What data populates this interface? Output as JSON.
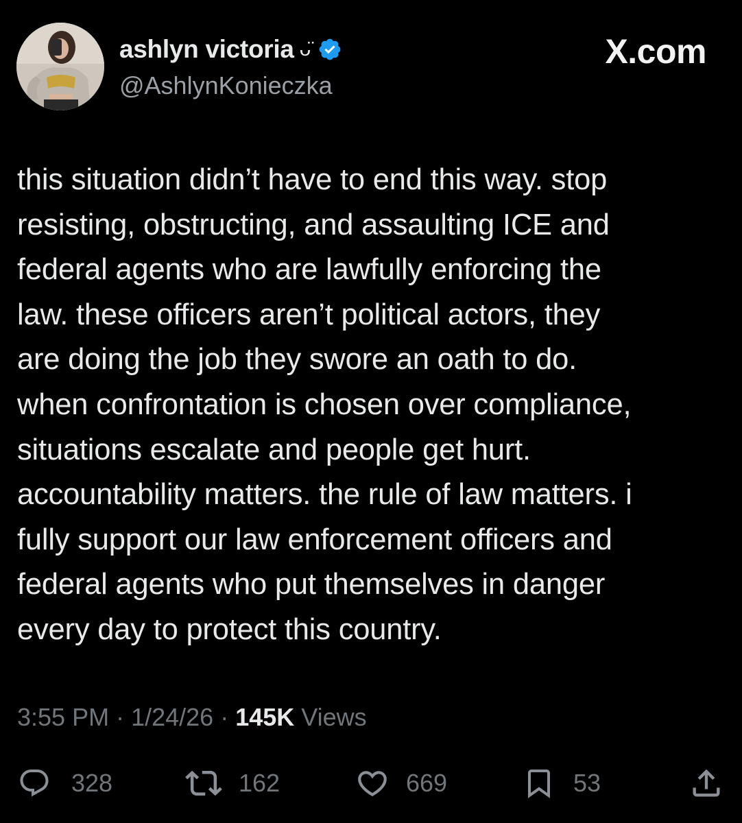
{
  "author": {
    "display_name": "ashlyn victoria",
    "name_emoji": "ᴗ̈",
    "handle": "@AshlynKonieczka",
    "verified_icon": "verified-badge-icon",
    "avatar_icon": "profile-photo"
  },
  "brand": {
    "label": "X.com"
  },
  "tweet": {
    "text": "this situation didn’t have to end this way. stop\nresisting, obstructing, and assaulting ICE and\nfederal agents who are lawfully enforcing the\nlaw. these officers aren’t political actors, they\nare doing the job they swore an oath to do.\nwhen confrontation is chosen over compliance,\nsituations escalate and people get hurt.\naccountability matters. the rule of law matters. i\nfully support our law enforcement officers and\nfederal agents who put themselves in danger\nevery day to protect this country."
  },
  "meta": {
    "time": "3:55 PM",
    "separator": " · ",
    "date": "1/24/26",
    "views_count": "145K",
    "views_label": " Views"
  },
  "actions": {
    "replies": {
      "icon": "reply-icon",
      "count": "328"
    },
    "reposts": {
      "icon": "repost-icon",
      "count": "162"
    },
    "likes": {
      "icon": "heart-icon",
      "count": "669"
    },
    "bookmarks": {
      "icon": "bookmark-icon",
      "count": "53"
    },
    "share": {
      "icon": "share-icon"
    }
  },
  "colors": {
    "background": "#000000",
    "text": "#e7e9ea",
    "muted": "#71767b",
    "verified_blue": "#1d9bf0"
  }
}
